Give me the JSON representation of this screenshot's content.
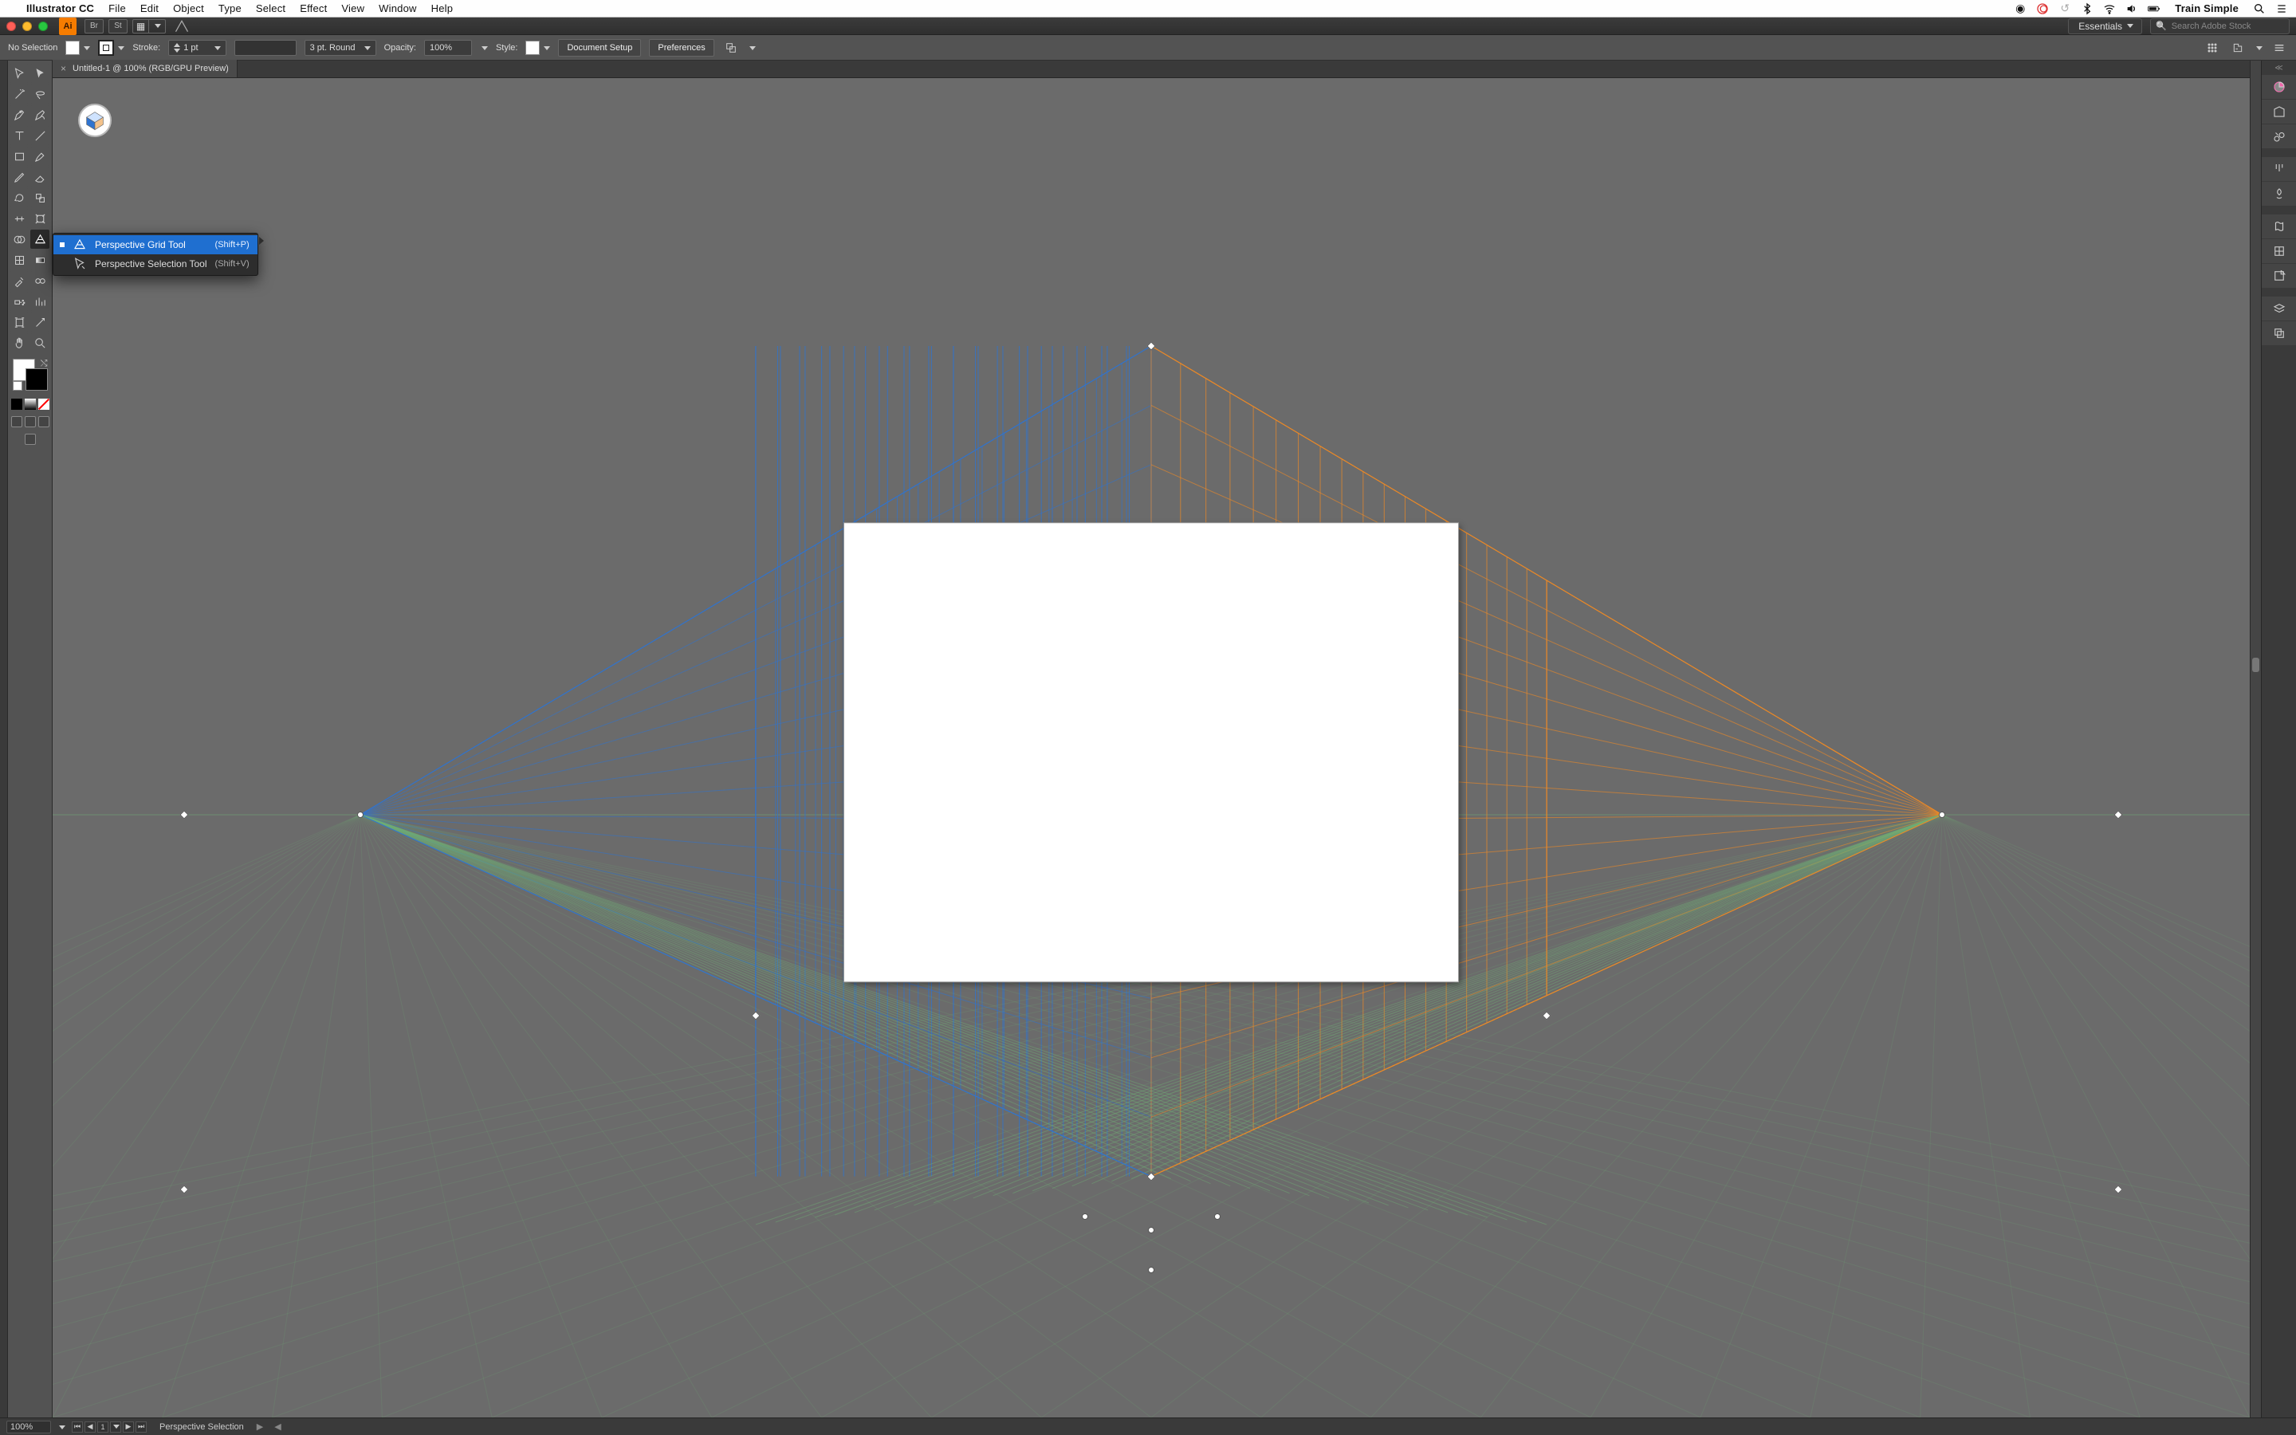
{
  "menubar": {
    "app": "Illustrator CC",
    "items": [
      "File",
      "Edit",
      "Object",
      "Type",
      "Select",
      "Effect",
      "View",
      "Window",
      "Help"
    ],
    "user": "Train Simple"
  },
  "chrome": {
    "badges": [
      "Br",
      "St"
    ],
    "workspace": "Essentials",
    "search_placeholder": "Search Adobe Stock"
  },
  "control": {
    "selection": "No Selection",
    "stroke_label": "Stroke:",
    "stroke_value": "1 pt",
    "brush_label": "3 pt. Round",
    "opacity_label": "Opacity:",
    "opacity_value": "100%",
    "style_label": "Style:",
    "btn_doc_setup": "Document Setup",
    "btn_prefs": "Preferences"
  },
  "document": {
    "tab_title": "Untitled-1 @ 100% (RGB/GPU Preview)"
  },
  "flyout": {
    "items": [
      {
        "name": "Perspective Grid Tool",
        "shortcut": "(Shift+P)",
        "selected": true
      },
      {
        "name": "Perspective Selection Tool",
        "shortcut": "(Shift+V)",
        "selected": false
      }
    ]
  },
  "toolbox": {
    "rows": [
      [
        "selection",
        "direct-selection"
      ],
      [
        "magic-wand",
        "lasso"
      ],
      [
        "pen",
        "curvature"
      ],
      [
        "type",
        "line"
      ],
      [
        "rectangle",
        "paintbrush"
      ],
      [
        "pencil",
        "eraser"
      ],
      [
        "rotate",
        "scale"
      ],
      [
        "width",
        "free-transform"
      ],
      [
        "shape-builder",
        "perspective"
      ],
      [
        "mesh",
        "gradient"
      ],
      [
        "eyedropper",
        "blend"
      ],
      [
        "symbol-sprayer",
        "column-graph"
      ],
      [
        "artboard",
        "slice"
      ],
      [
        "hand",
        "zoom"
      ]
    ],
    "selected": "perspective"
  },
  "dock": {
    "items": [
      "color",
      "swatches",
      "brushes",
      "separator",
      "symbols",
      "stroke",
      "separator2",
      "libraries",
      "align",
      "transform",
      "separator3",
      "layers",
      "artboards"
    ]
  },
  "status": {
    "zoom": "100%",
    "page": "1",
    "tool": "Perspective Selection"
  },
  "colors": {
    "grid_left": "#2f74d0",
    "grid_right": "#f08a24",
    "grid_floor": "#6fae75"
  }
}
